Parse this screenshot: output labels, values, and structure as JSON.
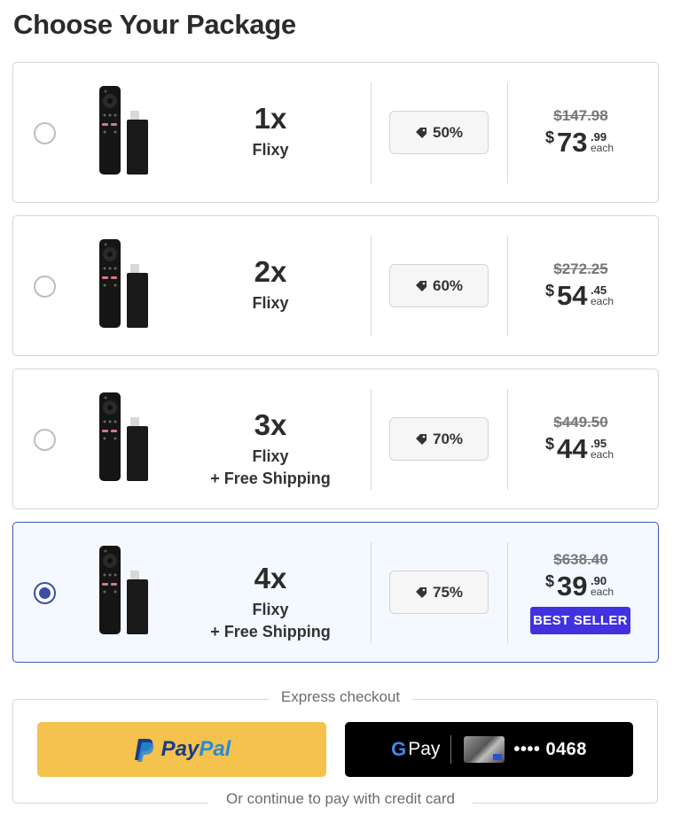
{
  "page_title": "Choose Your Package",
  "packages": [
    {
      "qty": "1x",
      "name": "Flixy",
      "shipping": "",
      "discount": "50%",
      "old_price": "$147.98",
      "currency": "$",
      "price_int": "73",
      "price_cents": ".99",
      "each": "each",
      "badge": "",
      "selected": false
    },
    {
      "qty": "2x",
      "name": "Flixy",
      "shipping": "",
      "discount": "60%",
      "old_price": "$272.25",
      "currency": "$",
      "price_int": "54",
      "price_cents": ".45",
      "each": "each",
      "badge": "",
      "selected": false
    },
    {
      "qty": "3x",
      "name": "Flixy",
      "shipping": "+ Free Shipping",
      "discount": "70%",
      "old_price": "$449.50",
      "currency": "$",
      "price_int": "44",
      "price_cents": ".95",
      "each": "each",
      "badge": "",
      "selected": false
    },
    {
      "qty": "4x",
      "name": "Flixy",
      "shipping": "+ Free Shipping",
      "discount": "75%",
      "old_price": "$638.40",
      "currency": "$",
      "price_int": "39",
      "price_cents": ".90",
      "each": "each",
      "badge": "BEST SELLER",
      "selected": true
    }
  ],
  "express": {
    "label": "Express checkout",
    "paypal_part1": "Pay",
    "paypal_part2": "Pal",
    "gpay_g": "G",
    "gpay_pay": "Pay",
    "card_number": "•••• 0468",
    "alt_label": "Or continue to pay with credit card"
  },
  "colors": {
    "accent": "#4131e0",
    "selected_border": "#3d57b0",
    "paypal_bg": "#f4c24d",
    "gpay_bg": "#000000"
  }
}
